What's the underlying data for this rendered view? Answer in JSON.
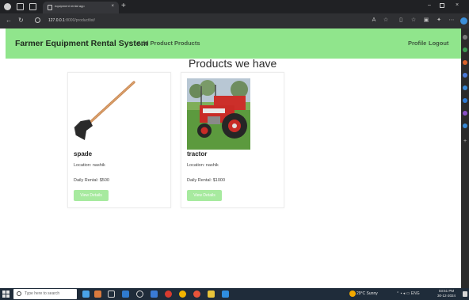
{
  "browser": {
    "tab_title": "equipment rental app",
    "tab_close": "×",
    "new_tab": "+",
    "url_host": "127.0.0.1",
    "url_path": ":8000/productlist/",
    "win_minimize": "–",
    "win_close": "×"
  },
  "navbar": {
    "brand": "Farmer Equipment Rental System",
    "links": [
      "Add Product",
      "Products"
    ],
    "right_links": [
      "Profile",
      "Logout"
    ],
    "background": "#90e58c"
  },
  "main": {
    "title": "Products we have",
    "products": [
      {
        "name": "spade",
        "location": "Location: nashik",
        "rental": "Daily Rental: $500",
        "button": "View Details",
        "image_icon": "spade-image"
      },
      {
        "name": "tractor",
        "location": "Location: nashik",
        "rental": "Daily Rental: $1000",
        "button": "View Details",
        "image_icon": "tractor-image"
      }
    ],
    "button_color": "#a7ea9f"
  },
  "taskbar": {
    "search_placeholder": "Type here to search",
    "weather": "29°C Sunny",
    "tray_lang": "ENG",
    "time": "03:51 PM",
    "date": "30-12-2024"
  }
}
